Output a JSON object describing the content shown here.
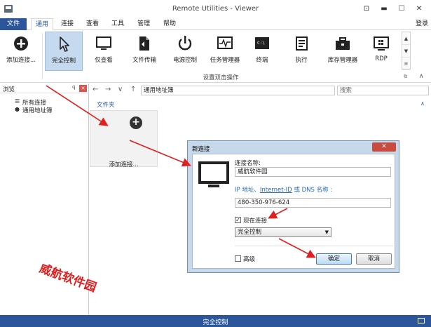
{
  "window": {
    "title": "Remote Utilities - Viewer",
    "controls": [
      "⊡",
      "▬",
      "☐",
      "✕"
    ]
  },
  "tabs": [
    {
      "label": "文件"
    },
    {
      "label": "通用"
    },
    {
      "label": "连接"
    },
    {
      "label": "查看"
    },
    {
      "label": "工具"
    },
    {
      "label": "管理"
    },
    {
      "label": "帮助"
    }
  ],
  "login_label": "登录",
  "ribbon": {
    "add_connection": "添加连接...",
    "buttons": [
      {
        "label": "完全控制",
        "icon": "cursor-icon"
      },
      {
        "label": "仅查看",
        "icon": "monitor-icon"
      },
      {
        "label": "文件传输",
        "icon": "file-transfer-icon"
      },
      {
        "label": "电源控制",
        "icon": "power-icon"
      },
      {
        "label": "任务管理器",
        "icon": "task-manager-icon"
      },
      {
        "label": "终端",
        "icon": "terminal-icon"
      },
      {
        "label": "执行",
        "icon": "execute-icon"
      },
      {
        "label": "库存管理器",
        "icon": "inventory-icon"
      },
      {
        "label": "RDP",
        "icon": "rdp-icon"
      }
    ],
    "group_label": "设置双击操作"
  },
  "left_panel": {
    "title": "浏览",
    "pin": "ꟼ",
    "close": "✕",
    "items": [
      {
        "label": "所有连接",
        "icon": "☰"
      },
      {
        "label": "通用地址簿",
        "icon": "●"
      }
    ]
  },
  "nav": {
    "back": "←",
    "forward": "→",
    "down": "∨",
    "up": "↑",
    "address": "通用地址簿",
    "search_placeholder": "搜索"
  },
  "content": {
    "folder_label": "文件夹",
    "tile_plus": "+",
    "tile_label": "添加连接..."
  },
  "dialog": {
    "title": "新连接",
    "close": "✕",
    "name_label": "连接名称:",
    "name_value": "威航软件园",
    "ip_label_parts": [
      "IP 地址、",
      "Internet-ID",
      " 或 DNS 名称 :"
    ],
    "ip_value": "480-350-976-624",
    "connect_now_label": "现在连接",
    "connect_now_checked": "✓",
    "mode_value": "完全控制",
    "advanced_label": "高级",
    "ok_label": "确定",
    "cancel_label": "取消"
  },
  "watermark": "威航软件园",
  "status": {
    "text": "完全控制"
  },
  "colors": {
    "accent": "#2b579a",
    "arrow": "#e02020"
  }
}
